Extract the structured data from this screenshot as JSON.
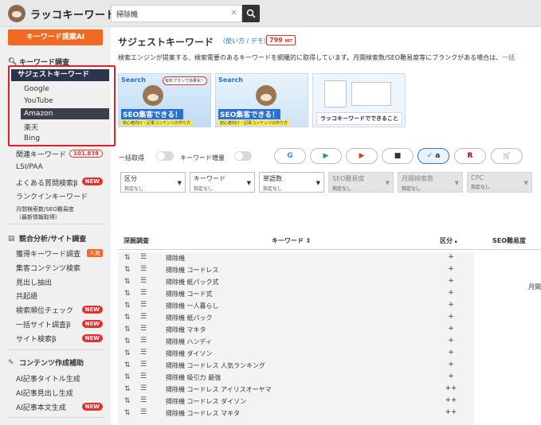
{
  "header": {
    "logo_text": "ラッコキーワード",
    "search_value": "掃除機",
    "clear_symbol": "×"
  },
  "sidebar": {
    "cta_label": "キーワード提案AI",
    "section1": "キーワード調査",
    "active_item": "サジェストキーワード",
    "engines": [
      "Google",
      "YouTube",
      "Amazon",
      "楽天",
      "Bing"
    ],
    "items1": [
      {
        "label": "関連キーワード",
        "badge": "101,838"
      },
      {
        "label": "LSI/PAA"
      },
      {
        "label": "よくある質問検索β",
        "badge": "NEW"
      },
      {
        "label": "ランクインキーワード"
      },
      {
        "label": "月間検索数/SEO難易度",
        "label2": "（最新情報取得）"
      }
    ],
    "section2": "競合分析/サイト調査",
    "items2": [
      {
        "label": "獲得キーワード調査",
        "badge": "人気"
      },
      {
        "label": "集客コンテンツ検索"
      },
      {
        "label": "見出し抽出"
      },
      {
        "label": "共起語"
      },
      {
        "label": "検索順位チェック",
        "badge": "NEW"
      },
      {
        "label": "一括サイト調査β",
        "badge": "NEW"
      },
      {
        "label": "サイト検索β",
        "badge": "NEW"
      }
    ],
    "section3": "コンテンツ作成補助",
    "items3": [
      {
        "label": "AI記事タイトル生成"
      },
      {
        "label": "AI記事見出し生成"
      },
      {
        "label": "AI記事本文生成",
        "badge": "NEW"
      }
    ]
  },
  "main": {
    "title": "サジェストキーワード",
    "howto": "（使い方 / デモ）",
    "hit_count": "799",
    "hit_unit": "HIT",
    "description": "検索エンジンが提案する、検索需要のあるキーワードを網羅的に取得しています。月間検索数/SEO難易度等にブランクがある場合は、",
    "description_link": "一括",
    "banners": {
      "b1_search": "Search",
      "b1_pill": "有料プランで効果化！",
      "b1_seo": "SEO集客できる！",
      "b1_sub": "初心者向け・記事コンテンツの作り方",
      "b2_search": "Search",
      "b2_seo": "SEO集客できる！",
      "b2_sub": "初心者向け・記事コンテンツの作り方",
      "b3_caption": "ラッコキーワードでできること"
    },
    "toggle1_label": "一括取得",
    "toggle2_label": "キーワード増量",
    "engines": [
      "G",
      "▶",
      "▶",
      "■",
      "a",
      "R",
      "🛒"
    ],
    "filters": [
      {
        "label": "区分",
        "value": "指定なし",
        "disabled": false
      },
      {
        "label": "キーワード",
        "value": "指定なし",
        "disabled": false
      },
      {
        "label": "単語数",
        "value": "指定なし",
        "disabled": false
      },
      {
        "label": "SEO難易度",
        "value": "指定なし",
        "disabled": true
      },
      {
        "label": "月間検索数",
        "value": "指定なし",
        "disabled": true
      },
      {
        "label": "CPC",
        "value": "指定なし",
        "disabled": true
      }
    ],
    "table": {
      "headers": {
        "deep": "深掘調査",
        "keyword": "キーワード ⇕",
        "category": "区分",
        "seo": "SEO難易度"
      },
      "side_value": "月間",
      "rows": [
        {
          "kw": "掃除機",
          "div": "+"
        },
        {
          "kw": "掃除機 コードレス",
          "div": "+"
        },
        {
          "kw": "掃除機 紙パック式",
          "div": "+"
        },
        {
          "kw": "掃除機 コード式",
          "div": "+"
        },
        {
          "kw": "掃除機 一人暮らし",
          "div": "+"
        },
        {
          "kw": "掃除機 紙パック",
          "div": "+"
        },
        {
          "kw": "掃除機 マキタ",
          "div": "+"
        },
        {
          "kw": "掃除機 ハンディ",
          "div": "+"
        },
        {
          "kw": "掃除機 ダイソン",
          "div": "+"
        },
        {
          "kw": "掃除機 コードレス 人気ランキング",
          "div": "+"
        },
        {
          "kw": "掃除機 吸引力 最強",
          "div": "+"
        },
        {
          "kw": "掃除機 コードレス アイリスオーヤマ",
          "div": "++"
        },
        {
          "kw": "掃除機 コードレス ダイソン",
          "div": "++"
        },
        {
          "kw": "掃除機 コードレス マキタ",
          "div": "++"
        }
      ]
    }
  },
  "colors": {
    "accent": "#f26a22",
    "highlight": "#e31f26",
    "active_nav": "#2a3550",
    "link": "#2a7ad0"
  }
}
